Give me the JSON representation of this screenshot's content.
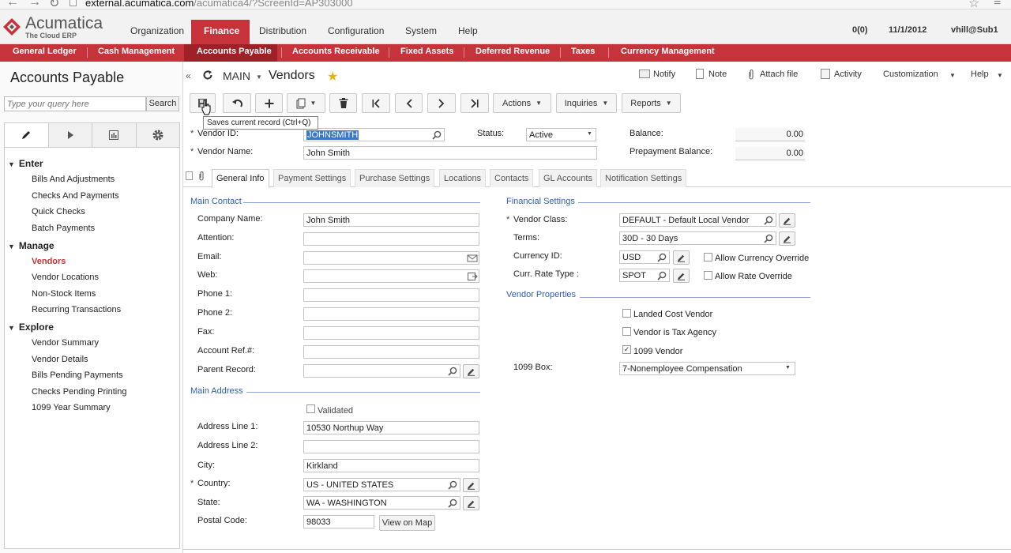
{
  "browser": {
    "url_host": "external.acumatica.com",
    "url_path": "/acumatica4/?ScreenId=AP303000"
  },
  "brand": {
    "name": "Acumatica",
    "tagline": "The Cloud ERP",
    "accent": "#c7333a"
  },
  "top_nav": {
    "items": [
      "Organization",
      "Finance",
      "Distribution",
      "Configuration",
      "System",
      "Help"
    ],
    "active": "Finance",
    "status": {
      "notifications": "0(0)",
      "date": "11/1/2012",
      "user": "vhill@Sub1"
    }
  },
  "sub_nav": {
    "items": [
      "General Ledger",
      "Cash Management",
      "Accounts Payable",
      "Accounts Receivable",
      "Fixed Assets",
      "Deferred Revenue",
      "Taxes",
      "Currency Management"
    ],
    "active": "Accounts Payable"
  },
  "left_panel": {
    "title": "Accounts Payable",
    "search_placeholder": "Type your query here",
    "search_button": "Search",
    "groups": [
      {
        "label": "Enter",
        "items": [
          "Bills And Adjustments",
          "Checks And Payments",
          "Quick Checks",
          "Batch Payments"
        ]
      },
      {
        "label": "Manage",
        "items": [
          "Vendors",
          "Vendor Locations",
          "Non-Stock Items",
          "Recurring Transactions"
        ]
      },
      {
        "label": "Explore",
        "items": [
          "Vendor Summary",
          "Vendor Details",
          "Bills Pending Payments",
          "Checks Pending Printing",
          "1099 Year Summary"
        ]
      }
    ],
    "active_item": "Vendors"
  },
  "header": {
    "crumb": "MAIN",
    "title": "Vendors",
    "links": {
      "notify": "Notify",
      "note": "Note",
      "attach": "Attach file",
      "activity": "Activity",
      "customization": "Customization",
      "help": "Help"
    }
  },
  "toolbar": {
    "actions": "Actions",
    "inquiries": "Inquiries",
    "reports": "Reports",
    "tooltip": "Saves current record (Ctrl+Q)"
  },
  "summary": {
    "vendor_id_label": "Vendor ID:",
    "vendor_id": "JOHNSMITH",
    "vendor_name_label": "Vendor Name:",
    "vendor_name": "John Smith",
    "status_label": "Status:",
    "status": "Active",
    "balance_label": "Balance:",
    "balance": "0.00",
    "prepayment_label": "Prepayment Balance:",
    "prepayment": "0.00"
  },
  "tabs": [
    "General Info",
    "Payment Settings",
    "Purchase Settings",
    "Locations",
    "Contacts",
    "GL Accounts",
    "Notification Settings"
  ],
  "active_tab": "General Info",
  "main_contact": {
    "section": "Main Contact",
    "company_name_label": "Company Name:",
    "company_name": "John Smith",
    "attention_label": "Attention:",
    "attention": "",
    "email_label": "Email:",
    "email": "",
    "web_label": "Web:",
    "web": "",
    "phone1_label": "Phone 1:",
    "phone1": "",
    "phone2_label": "Phone 2:",
    "phone2": "",
    "fax_label": "Fax:",
    "fax": "",
    "account_ref_label": "Account Ref.#:",
    "account_ref": "",
    "parent_record_label": "Parent Record:",
    "parent_record": ""
  },
  "main_address": {
    "section": "Main Address",
    "validated_label": "Validated",
    "validated": false,
    "line1_label": "Address Line 1:",
    "line1": "10530 Northup Way",
    "line2_label": "Address Line 2:",
    "line2": "",
    "city_label": "City:",
    "city": "Kirkland",
    "country_label": "Country:",
    "country": "US - UNITED STATES",
    "state_label": "State:",
    "state": "WA - WASHINGTON",
    "postal_label": "Postal Code:",
    "postal": "98033",
    "view_map": "View on Map"
  },
  "financial": {
    "section": "Financial Settings",
    "vendor_class_label": "Vendor Class:",
    "vendor_class": "DEFAULT - Default Local Vendor",
    "terms_label": "Terms:",
    "terms": "30D - 30 Days",
    "currency_label": "Currency ID:",
    "currency": "USD",
    "allow_currency_override": "Allow Currency Override",
    "rate_type_label": "Curr. Rate Type :",
    "rate_type": "SPOT",
    "allow_rate_override": "Allow Rate Override"
  },
  "vendor_props": {
    "section": "Vendor Properties",
    "landed_cost": "Landed Cost Vendor",
    "landed_cost_checked": false,
    "tax_agency": "Vendor is Tax Agency",
    "tax_agency_checked": false,
    "v1099": "1099 Vendor",
    "v1099_checked": true,
    "box_label": "1099 Box:",
    "box": "7-Nonemployee Compensation"
  },
  "icons": [
    "back-icon",
    "forward-icon",
    "reload-icon",
    "page-icon",
    "bookmark-star-icon",
    "browser-menu-icon",
    "acumatica-logo-icon",
    "pencil-icon",
    "play-icon",
    "report-icon",
    "gear-icon",
    "collapse-icon",
    "refresh-icon",
    "favorite-star-icon",
    "notify-icon",
    "note-icon",
    "paperclip-icon",
    "activity-icon",
    "save-icon",
    "undo-icon",
    "add-icon",
    "copy-icon",
    "delete-icon",
    "first-icon",
    "previous-icon",
    "next-icon",
    "last-icon",
    "search-icon",
    "edit-icon",
    "mail-icon",
    "link-icon"
  ]
}
